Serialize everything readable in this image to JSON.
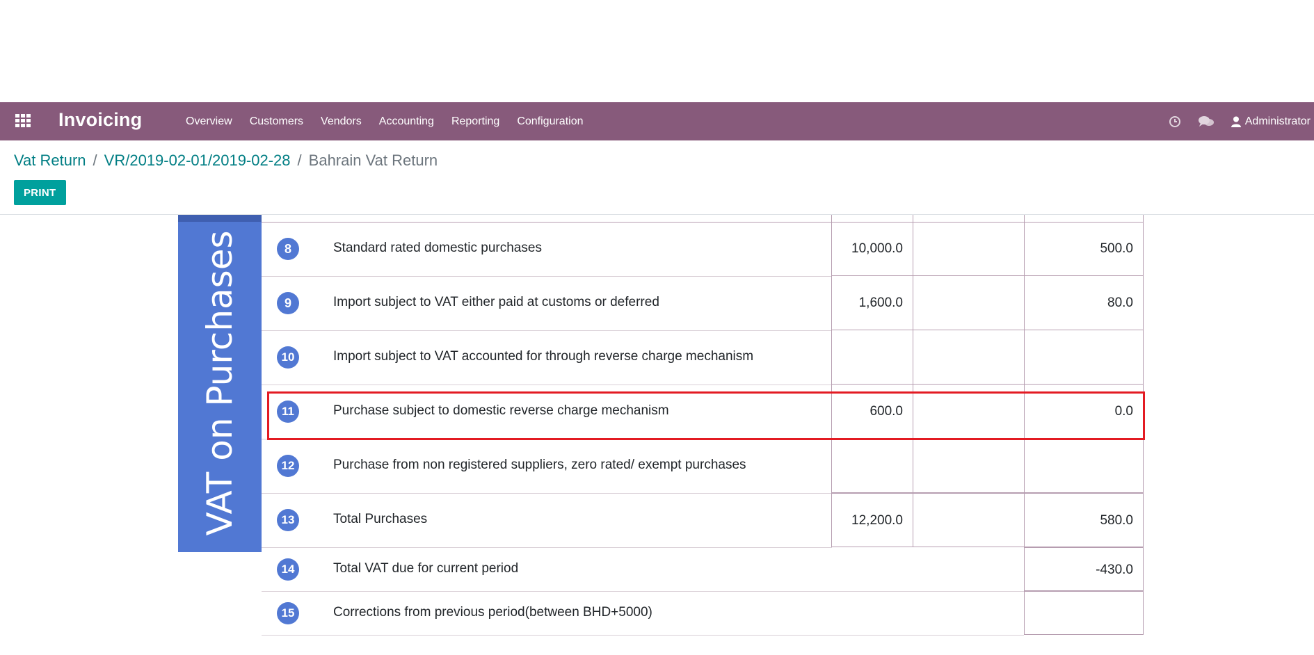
{
  "navbar": {
    "app_title": "Invoicing",
    "menu": [
      "Overview",
      "Customers",
      "Vendors",
      "Accounting",
      "Reporting",
      "Configuration"
    ],
    "user": "Administrator",
    "bg_color": "#875a7b"
  },
  "breadcrumb": {
    "items": [
      "Vat Return",
      "VR/2019-02-01/2019-02-28"
    ],
    "current": "Bahrain Vat Return"
  },
  "buttons": {
    "print": "PRINT"
  },
  "report": {
    "section_label": "VAT on Purchases",
    "rows": [
      {
        "num": "8",
        "desc": "Standard rated domestic purchases",
        "amount": "10,000.0",
        "adj": "",
        "vat": "500.0"
      },
      {
        "num": "9",
        "desc": "Import subject to VAT either paid at customs or deferred",
        "amount": "1,600.0",
        "adj": "",
        "vat": "80.0"
      },
      {
        "num": "10",
        "desc": "Import subject to VAT accounted for through reverse charge mechanism",
        "amount": "",
        "adj": "",
        "vat": ""
      },
      {
        "num": "11",
        "desc": "Purchase subject to domestic reverse charge mechanism",
        "amount": "600.0",
        "adj": "",
        "vat": "0.0"
      },
      {
        "num": "12",
        "desc": "Purchase from non registered suppliers, zero rated/ exempt purchases",
        "amount": "",
        "adj": "",
        "vat": ""
      },
      {
        "num": "13",
        "desc": "Total Purchases",
        "amount": "12,200.0",
        "adj": "",
        "vat": "580.0"
      },
      {
        "num": "14",
        "desc": "Total VAT due for current period",
        "amount": "",
        "adj": "",
        "vat": "-430.0"
      },
      {
        "num": "15",
        "desc": "Corrections from previous period(between BHD+5000)",
        "amount": "",
        "adj": "",
        "vat": ""
      }
    ],
    "highlighted_row": "11",
    "highlight_color": "#e31b23",
    "badge_color": "#5178d3"
  }
}
